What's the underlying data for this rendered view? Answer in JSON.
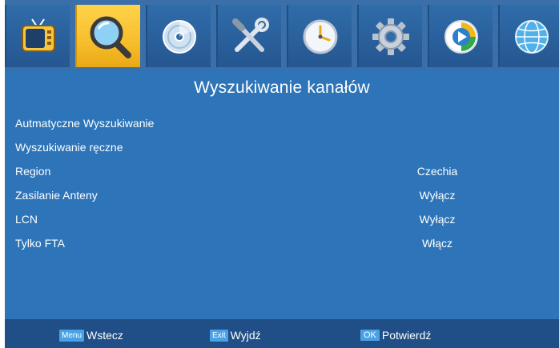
{
  "menu": {
    "tabs": [
      {
        "icon": "tv-icon",
        "active": false
      },
      {
        "icon": "search-icon",
        "active": true
      },
      {
        "icon": "disc-icon",
        "active": false
      },
      {
        "icon": "tools-icon",
        "active": false
      },
      {
        "icon": "clock-icon",
        "active": false
      },
      {
        "icon": "gear-icon",
        "active": false
      },
      {
        "icon": "play-icon",
        "active": false
      },
      {
        "icon": "globe-icon",
        "active": false
      }
    ]
  },
  "page": {
    "title": "Wyszukiwanie kanałów"
  },
  "settings": [
    {
      "label": "Autmatyczne Wyszukiwanie",
      "value": ""
    },
    {
      "label": "Wyszukiwanie ręczne",
      "value": ""
    },
    {
      "label": "Region",
      "value": "Czechia"
    },
    {
      "label": "Zasilanie Anteny",
      "value": "Wyłącz"
    },
    {
      "label": "LCN",
      "value": "Wyłącz"
    },
    {
      "label": "Tylko FTA",
      "value": "Włącz"
    }
  ],
  "footer": {
    "menu_key": "Menu",
    "menu_label": "Wstecz",
    "exit_key": "Exit",
    "exit_label": "Wyjdź",
    "ok_key": "OK",
    "ok_label": "Potwierdź"
  },
  "colors": {
    "panel": "#2d74b8",
    "footer": "#1f4f86",
    "active_tab": "#f7be2c",
    "key_badge": "#4aa2e6"
  }
}
